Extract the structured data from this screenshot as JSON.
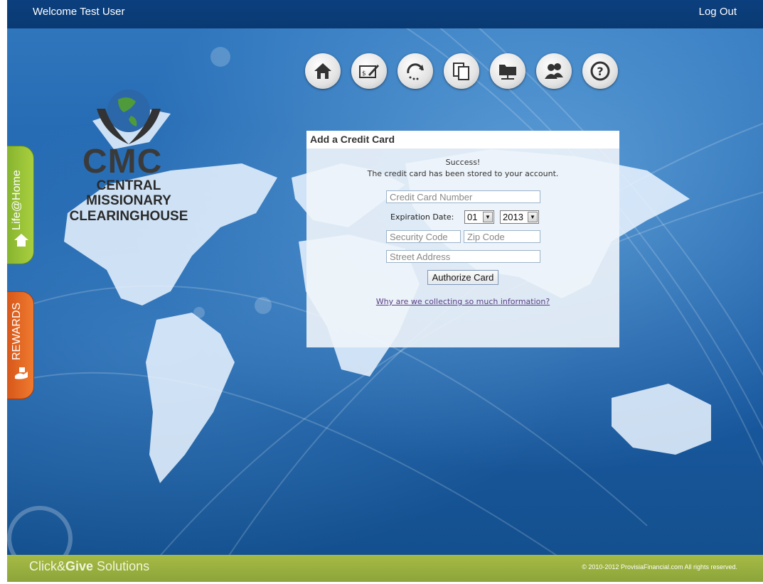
{
  "header": {
    "welcome": "Welcome Test User",
    "logout": "Log Out"
  },
  "logo": {
    "abbr": "CMC",
    "line1": "CENTRAL",
    "line2": "MISSIONARY",
    "line3": "CLEARINGHOUSE"
  },
  "nav": [
    {
      "name": "home-icon"
    },
    {
      "name": "payment-icon"
    },
    {
      "name": "refresh-icon"
    },
    {
      "name": "documents-icon"
    },
    {
      "name": "folder-network-icon"
    },
    {
      "name": "users-icon"
    },
    {
      "name": "help-icon"
    }
  ],
  "panel": {
    "title": "Add a Credit Card",
    "success": "Success!",
    "message": "The credit card has been stored to your account.",
    "card_placeholder": "Credit Card Number",
    "expiration_label": "Expiration Date:",
    "month": "01",
    "year": "2013",
    "security_placeholder": "Security Code",
    "zip_placeholder": "Zip Code",
    "street_placeholder": "Street Address",
    "authorize_label": "Authorize Card",
    "why_link": "Why are we collecting so much information?"
  },
  "tabs": {
    "life": "Life@Home",
    "rewards": "REWARDS"
  },
  "footer": {
    "brand_prefix": "Click&",
    "brand_bold": "Give",
    "brand_suffix": " Solutions",
    "copyright": "© 2010-2012 ProvisiaFinancial.com    All rights reserved."
  },
  "colors": {
    "topbar": "#0b3f7d",
    "footer": "#9db243",
    "life_tab": "#8fbd34",
    "rewards_tab": "#e0622a"
  }
}
